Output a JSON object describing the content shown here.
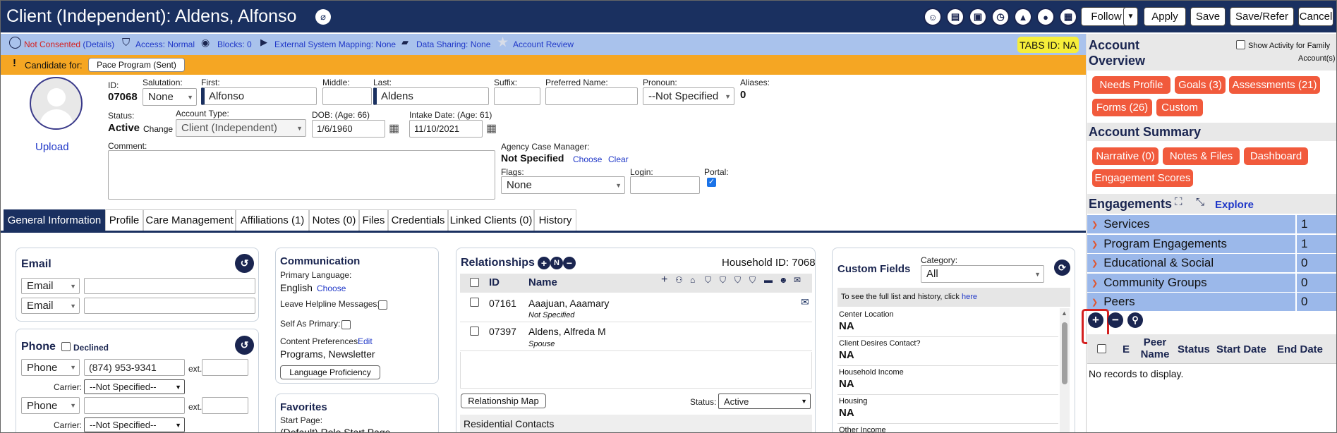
{
  "header": {
    "title": "Client (Independent): Aldens, Alfonso",
    "buttons": {
      "follow": "Follow",
      "apply": "Apply",
      "save": "Save",
      "save_refer": "Save/Refer",
      "cancel": "Cancel"
    },
    "icons": [
      "user-check-icon",
      "id-card-icon",
      "briefcase-icon",
      "clock-icon",
      "lock-icon",
      "user-circle-icon",
      "building-icon"
    ]
  },
  "infobar": {
    "not_consented": "Not Consented",
    "details": "(Details)",
    "access": "Access: Normal",
    "blocks": "Blocks: 0",
    "external": "External System Mapping: None",
    "sharing": "Data Sharing: None",
    "review": "Account Review",
    "tabs_id": "TABS ID: NA"
  },
  "candidate": {
    "label": "Candidate for:",
    "button": "Pace Program (Sent)"
  },
  "profile": {
    "upload": "Upload",
    "id_label": "ID:",
    "id": "07068",
    "salutation_label": "Salutation:",
    "salutation": "None",
    "first_label": "First:",
    "first": "Alfonso",
    "middle_label": "Middle:",
    "middle": "",
    "last_label": "Last:",
    "last": "Aldens",
    "suffix_label": "Suffix:",
    "suffix": "",
    "preferred_label": "Preferred Name:",
    "preferred": "",
    "pronoun_label": "Pronoun:",
    "pronoun": "--Not Specified",
    "aliases_label": "Aliases:",
    "aliases": "0",
    "status_label": "Status:",
    "status": "Active",
    "change": "Change",
    "account_type_label": "Account Type:",
    "account_type": "Client (Independent)",
    "dob_label": "DOB: (Age: 66)",
    "dob": "1/6/1960",
    "intake_label": "Intake Date: (Age: 61)",
    "intake": "11/10/2021",
    "comment_label": "Comment:",
    "case_mgr_label": "Agency Case Manager:",
    "case_mgr": "Not Specified",
    "choose": "Choose",
    "clear": "Clear",
    "flags_label": "Flags:",
    "flags": "None",
    "login_label": "Login:",
    "portal_label": "Portal:"
  },
  "tabs": [
    "General Information",
    "Profile",
    "Care Management",
    "Affiliations (1)",
    "Notes (0)",
    "Files",
    "Credentials",
    "Linked Clients (0)",
    "History"
  ],
  "email": {
    "title": "Email",
    "type1": "Email",
    "type2": "Email"
  },
  "phone": {
    "title": "Phone",
    "declined": "Declined",
    "type1": "Phone",
    "number1": "(874) 953-9341",
    "ext_label": "ext.",
    "carrier_label": "Carrier:",
    "carrier1": "--Not Specified--",
    "type2": "Phone",
    "carrier2": "--Not Specified--"
  },
  "communication": {
    "title": "Communication",
    "lang_label": "Primary Language:",
    "lang": "English",
    "choose": "Choose",
    "helpline": "Leave Helpline Messages:",
    "self_primary": "Self As Primary:",
    "content_label": "Content Preferences:",
    "edit": "Edit",
    "content": "Programs, Newsletter",
    "lang_button": "Language Proficiency"
  },
  "favorites": {
    "title": "Favorites",
    "start_label": "Start Page:",
    "start": "(Default) Role Start Page"
  },
  "relationships": {
    "title": "Relationships",
    "household": "Household ID: 7068",
    "col_id": "ID",
    "col_name": "Name",
    "rows": [
      {
        "id": "07161",
        "name": "Aaajuan, Aaamary",
        "rel": "Not Specified"
      },
      {
        "id": "07397",
        "name": "Aldens, Alfreda M",
        "rel": "Spouse"
      }
    ],
    "map_button": "Relationship Map",
    "status_label": "Status:",
    "status": "Active",
    "residential": "Residential Contacts"
  },
  "custom_fields": {
    "title": "Custom Fields",
    "category_label": "Category:",
    "category": "All",
    "note": "To see the full list and history, click",
    "here": "here",
    "fields": [
      {
        "label": "Center Location",
        "value": "NA"
      },
      {
        "label": "Client Desires Contact?",
        "value": "NA"
      },
      {
        "label": "Household Income",
        "value": "NA"
      },
      {
        "label": "Housing",
        "value": "NA"
      },
      {
        "label": "Other Income",
        "value": ""
      }
    ]
  },
  "right": {
    "overview_title": "Account Overview",
    "show_family": "Show Activity for Family",
    "accounts": "Account(s)",
    "overview_pills": [
      "Needs Profile",
      "Goals (3)",
      "Assessments (21)",
      "Forms (26)",
      "Custom"
    ],
    "summary_title": "Account Summary",
    "summary_pills": [
      "Narrative (0)",
      "Notes & Files",
      "Dashboard",
      "Engagement Scores"
    ],
    "engagements_title": "Engagements",
    "explore": "Explore",
    "engagements": [
      {
        "name": "Services",
        "count": "1"
      },
      {
        "name": "Program Engagements",
        "count": "1"
      },
      {
        "name": "Educational & Social",
        "count": "0"
      },
      {
        "name": "Community Groups",
        "count": "0"
      },
      {
        "name": "Peers",
        "count": "0"
      }
    ],
    "peer_cols": [
      "E",
      "Peer Name",
      "Status",
      "Start Date",
      "End Date"
    ],
    "no_records": "No records to display."
  },
  "colors": {
    "header": "#1a3060",
    "orange": "#f5a623",
    "pill": "#f15a3c",
    "eng_row": "#9bb8ea",
    "info_bar": "#a9c2ec"
  }
}
